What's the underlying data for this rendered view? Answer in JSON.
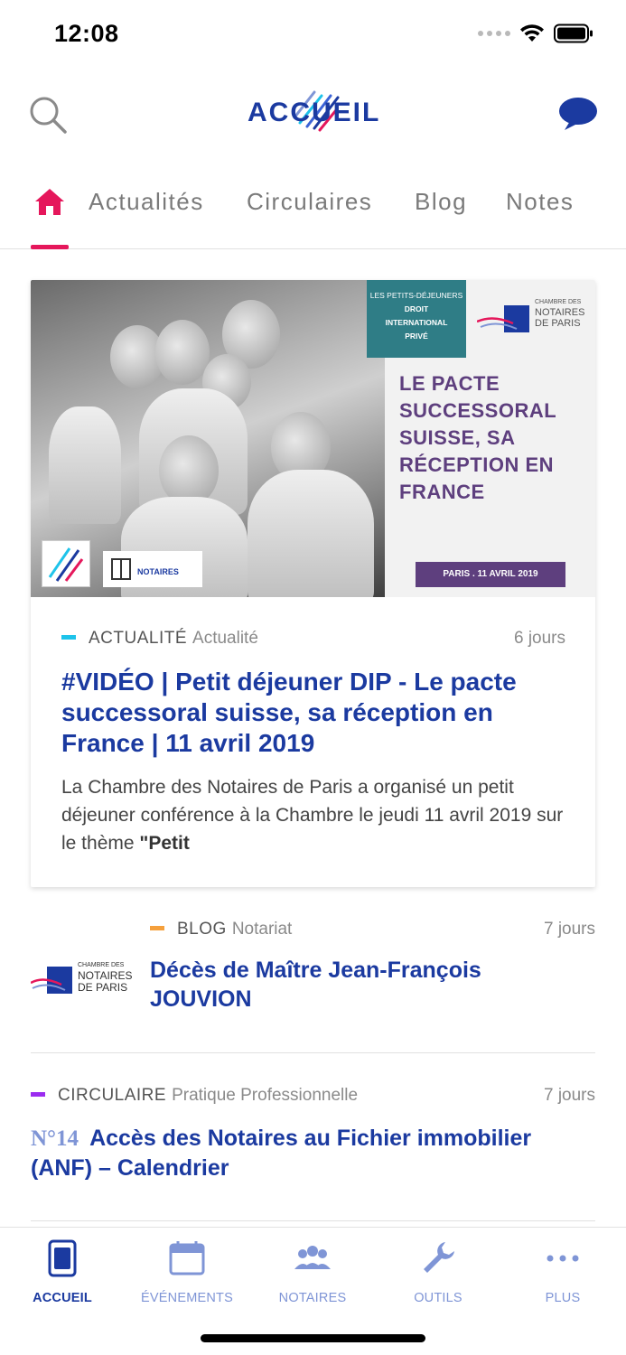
{
  "status_bar": {
    "time": "12:08"
  },
  "header": {
    "logo_text": "ACCUEIL"
  },
  "colors": {
    "accent": "#e5175b",
    "title_blue": "#1b3aa0",
    "actualite": "#1ec3ea",
    "blog": "#f5a03c",
    "circulaire": "#9b2cf0",
    "nav_active": "#1b3aa0",
    "nav_inactive": "#7f95d6"
  },
  "tabs": [
    {
      "label": "Actualités"
    },
    {
      "label": "Circulaires"
    },
    {
      "label": "Blog"
    },
    {
      "label": "Notes"
    }
  ],
  "featured": {
    "image": {
      "badge_top": "LES PETITS-DÉJEUNERS",
      "badge_mid1": "DROIT",
      "badge_mid2": "INTERNATIONAL",
      "badge_mid3": "PRIVÉ",
      "org_line1": "CHAMBRE DES",
      "org_line2": "NOTAIRES",
      "org_line3": "DE PARIS",
      "poster_title": "LE PACTE SUCCESSORAL SUISSE, SA RÉCEPTION EN FRANCE",
      "poster_date": "PARIS . 11 AVRIL 2019",
      "badge_right_label": "NOTAIRES"
    },
    "category": "ACTUALITÉ",
    "subcategory": "Actualité",
    "date": "6 jours",
    "title": "#VIDÉO | Petit déjeuner DIP - Le pacte successoral suisse, sa réception en France | 11 avril 2019",
    "excerpt_plain": "La Chambre des Notaires de Paris a organisé un petit déjeuner conférence à la Chambre le jeudi 11 avril 2019 sur le thème ",
    "excerpt_bold": "\"Petit"
  },
  "blog_item": {
    "thumb_line1": "CHAMBRE DES",
    "thumb_line2": "NOTAIRES",
    "thumb_line3": "DE PARIS",
    "category": "BLOG",
    "subcategory": "Notariat",
    "date": "7 jours",
    "title": "Décès de Maître Jean-François JOUVION"
  },
  "circ_item": {
    "category": "CIRCULAIRE",
    "subcategory": "Pratique Professionnelle",
    "date": "7 jours",
    "number": "N°14",
    "title": "Accès des Notaires au Fichier immobilier (ANF) – Calendrier"
  },
  "bottom_nav": [
    {
      "label": "ACCUEIL",
      "icon": "home-book-icon",
      "active": true
    },
    {
      "label": "ÉVÉNEMENTS",
      "icon": "calendar-icon",
      "active": false
    },
    {
      "label": "NOTAIRES",
      "icon": "people-icon",
      "active": false
    },
    {
      "label": "OUTILS",
      "icon": "wrench-icon",
      "active": false
    },
    {
      "label": "PLUS",
      "icon": "more-icon",
      "active": false
    }
  ]
}
